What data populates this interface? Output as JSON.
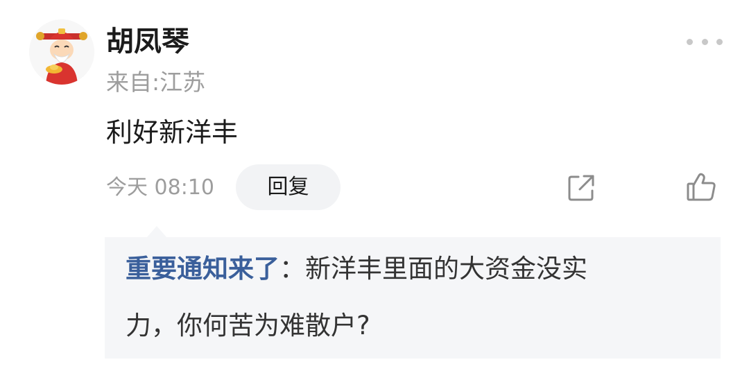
{
  "comment": {
    "username": "胡凤琴",
    "location": "来自:江苏",
    "text": "利好新洋丰",
    "time": "今天 08:10",
    "reply_label": "回复",
    "icons": {
      "avatar": "caishen-avatar",
      "more": "more-dots-icon",
      "share": "share-icon",
      "like": "thumbs-up-icon"
    }
  },
  "quoted_reply": {
    "author": "重要通知来了",
    "separator": "：",
    "text_line1": "新洋丰里面的大资金没实",
    "text_line2": "力，你何苦为难散户?"
  },
  "colors": {
    "author_link": "#3a5f9b",
    "secondary_text": "#9d9d9d",
    "reply_bg": "#f5f6f8",
    "button_bg": "#f2f3f5"
  }
}
